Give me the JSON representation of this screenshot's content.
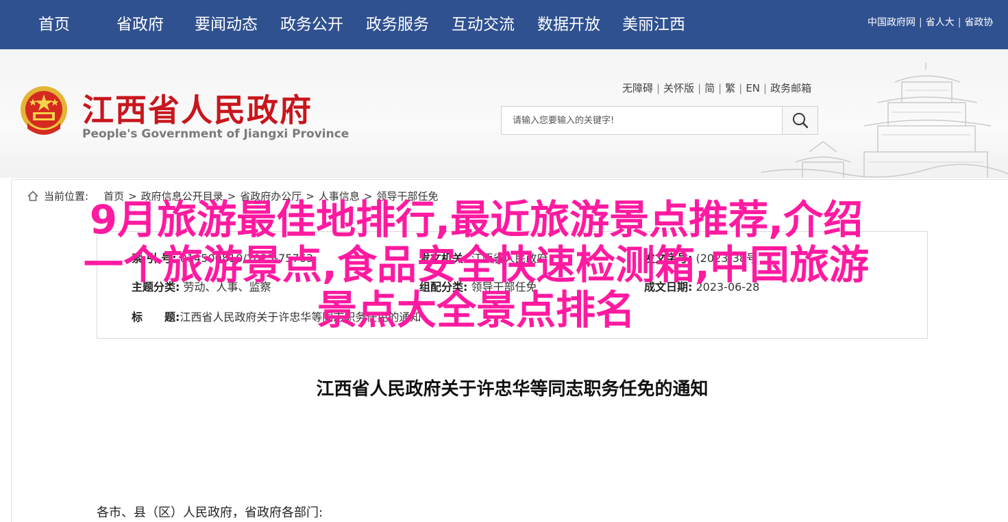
{
  "topnav": {
    "items": [
      "首页",
      "省政府",
      "要闻动态",
      "政务公开",
      "政务服务",
      "互动交流",
      "数据开放",
      "美丽江西"
    ],
    "right_links": [
      "中国政府网",
      "省人大",
      "省政协"
    ]
  },
  "header": {
    "title": "江西省人民政府",
    "subtitle": "People's Government of Jiangxi Province",
    "access_links": [
      "无障碍",
      "关怀版",
      "简",
      "繁",
      "EN",
      "政务邮箱"
    ],
    "search_placeholder": "请输入您要输入的关键字!"
  },
  "breadcrumb": {
    "label": "当前位置:",
    "items": [
      "首页",
      "政府信息公开目录",
      "省政府办公厅",
      "人事信息",
      "领导干部任免"
    ]
  },
  "info": {
    "index_label": "索 引 号:",
    "index_value": "014500810/2023-75763",
    "issuer_label": "发文机关:",
    "issuer_value": "江西省人民政府",
    "topic_label": "主题分类:",
    "topic_value": "劳动、人事、监察",
    "category_label": "组配分类:",
    "category_value": "领导干部任免",
    "docno_label": "发文字号:",
    "docno_value": "(2023)38号",
    "date_label": "成文日期:",
    "date_value": "2023-06-28",
    "subject_label": "标　　题:",
    "subject_value": "江西省人民政府关于许忠华等同志职务任免的通知"
  },
  "document": {
    "title": "江西省人民政府关于许忠华等同志职务任免的通知",
    "salutation": "各市、县（区）人民政府，省政府各部门:"
  },
  "overlay": {
    "line1": "9月旅游最佳地排行,最近旅游景点推荐,介绍",
    "line2": "一个旅游景点,食品安全快速检测箱,中国旅游",
    "line3": "景点大全景点排名"
  },
  "colors": {
    "nav_bg": "#2f5190",
    "title_red": "#c8161d",
    "overlay_pink": "#ff1aa0"
  }
}
